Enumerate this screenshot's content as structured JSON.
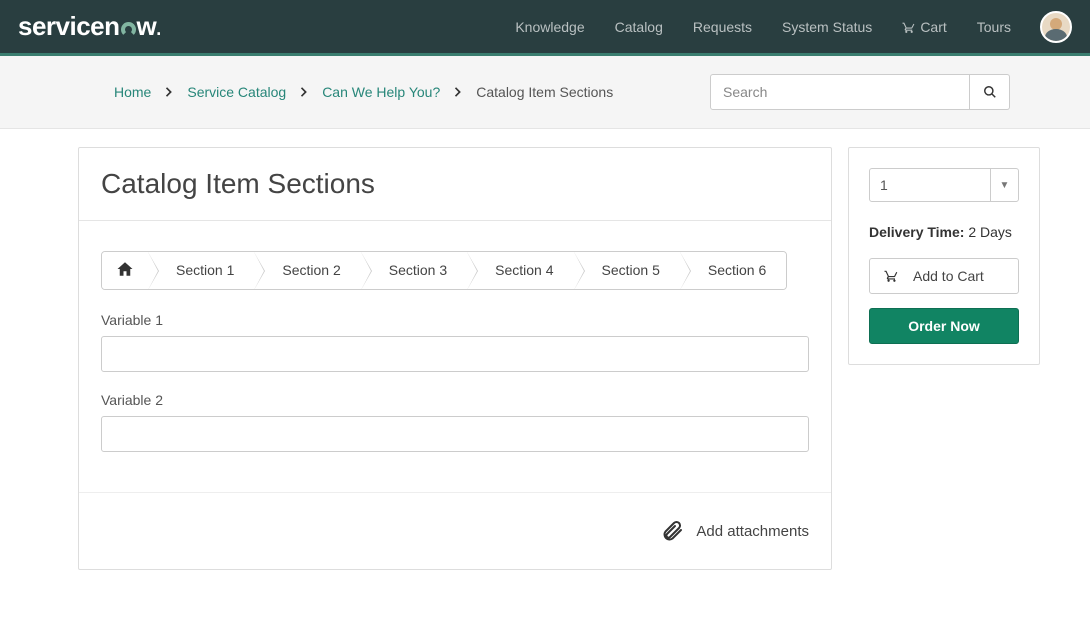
{
  "brand": {
    "pre": "servicen",
    "post": "w"
  },
  "nav": {
    "knowledge": "Knowledge",
    "catalog": "Catalog",
    "requests": "Requests",
    "system_status": "System Status",
    "cart": "Cart",
    "tours": "Tours"
  },
  "breadcrumbs": {
    "home": "Home",
    "service_catalog": "Service Catalog",
    "can_we_help": "Can We Help You?",
    "current": "Catalog Item Sections"
  },
  "search": {
    "placeholder": "Search"
  },
  "page": {
    "title": "Catalog Item Sections",
    "sections": {
      "s1": "Section 1",
      "s2": "Section 2",
      "s3": "Section 3",
      "s4": "Section 4",
      "s5": "Section 5",
      "s6": "Section 6"
    },
    "fields": {
      "var1_label": "Variable 1",
      "var1_value": "",
      "var2_label": "Variable 2",
      "var2_value": ""
    },
    "add_attachments": "Add attachments"
  },
  "sidebar": {
    "quantity": "1",
    "delivery_label": "Delivery Time:",
    "delivery_value": "2 Days",
    "add_to_cart": "Add to Cart",
    "order_now": "Order Now"
  }
}
